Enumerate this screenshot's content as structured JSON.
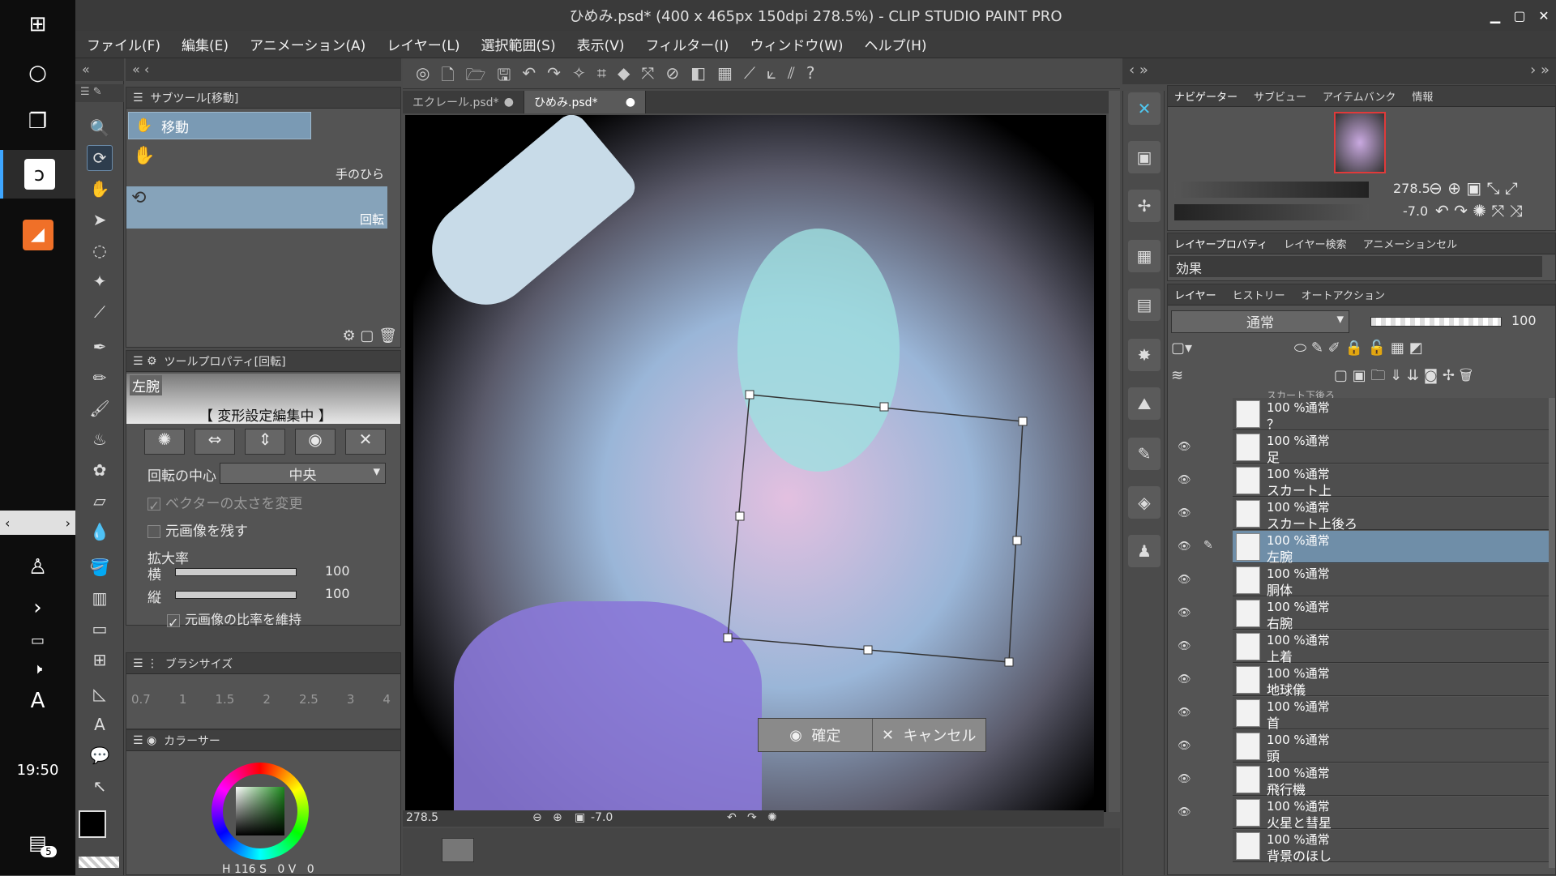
{
  "window": {
    "title": "ひめみ.psd* (400 x 465px 150dpi 278.5%)  - CLIP STUDIO PAINT PRO"
  },
  "taskbar": {
    "clock": "19:50",
    "notification_count": "5",
    "keyboard_mode": "A"
  },
  "menu": [
    "ファイル(F)",
    "編集(E)",
    "アニメーション(A)",
    "レイヤー(L)",
    "選択範囲(S)",
    "表示(V)",
    "フィルター(I)",
    "ウィンドウ(W)",
    "ヘルプ(H)"
  ],
  "subtool_panel": {
    "header": "サブツール[移動]",
    "group_label": "移動",
    "items": [
      {
        "label": "手のひら"
      },
      {
        "label": "回転"
      }
    ]
  },
  "tool_property": {
    "header": "ツールプロパティ[回転]",
    "layer_name": "左腕",
    "mode_label": "【 変形設定編集中 】",
    "rotation_center_label": "回転の中心",
    "rotation_center_value": "中央",
    "vector_thickness_label": "ベクターの太さを変更",
    "keep_original_label": "元画像を残す",
    "scale_label": "拡大率",
    "horizontal_label": "横",
    "horizontal_value": "100",
    "vertical_label": "縦",
    "vertical_value": "100",
    "keep_ratio_label": "元画像の比率を維持"
  },
  "brush_size": {
    "header": "ブラシサイズ",
    "sizes": [
      "0.7",
      "1",
      "1.5",
      "2",
      "2.5",
      "3",
      "4"
    ]
  },
  "color_panel": {
    "header": "カラーサー",
    "h": "116",
    "s": "0",
    "v": "0",
    "h_label": "H",
    "s_label": "S",
    "v_label": "V",
    "colors": {
      "main": "#000000",
      "sub": "#ffffff"
    }
  },
  "tabs": [
    {
      "label": "エクレール.psd*"
    },
    {
      "label": "ひめみ.psd*"
    }
  ],
  "canvas": {
    "confirm_label": "確定",
    "cancel_label": "キャンセル",
    "zoom": "278.5",
    "angle": "-7.0"
  },
  "navigator": {
    "tabs": [
      "ナビゲーター",
      "サブビュー",
      "アイテムバンク",
      "情報"
    ],
    "zoom": "278.5",
    "angle": "-7.0"
  },
  "layer_property": {
    "tabs": [
      "レイヤープロパティ",
      "レイヤー検索",
      "アニメーションセル"
    ],
    "effect_label": "効果"
  },
  "layer_panel": {
    "tabs": [
      "レイヤー",
      "ヒストリー",
      "オートアクション"
    ],
    "blend_mode": "通常",
    "opacity": "100",
    "partial_top": "スカート下後ろ",
    "layers": [
      {
        "meta": "100 %通常",
        "name": "？",
        "visible": false
      },
      {
        "meta": "100 %通常",
        "name": "足",
        "visible": true
      },
      {
        "meta": "100 %通常",
        "name": "スカート上",
        "visible": true
      },
      {
        "meta": "100 %通常",
        "name": "スカート上後ろ",
        "visible": true
      },
      {
        "meta": "100 %通常",
        "name": "左腕",
        "visible": true,
        "selected": true
      },
      {
        "meta": "100 %通常",
        "name": "胴体",
        "visible": true
      },
      {
        "meta": "100 %通常",
        "name": "右腕",
        "visible": true
      },
      {
        "meta": "100 %通常",
        "name": "上着",
        "visible": true
      },
      {
        "meta": "100 %通常",
        "name": "地球儀",
        "visible": true
      },
      {
        "meta": "100 %通常",
        "name": "首",
        "visible": true
      },
      {
        "meta": "100 %通常",
        "name": "頭",
        "visible": true
      },
      {
        "meta": "100 %通常",
        "name": "飛行機",
        "visible": true
      },
      {
        "meta": "100 %通常",
        "name": "火星と彗星",
        "visible": true
      },
      {
        "meta": "100 %通常",
        "name": "背景のほし",
        "visible": false
      }
    ]
  }
}
